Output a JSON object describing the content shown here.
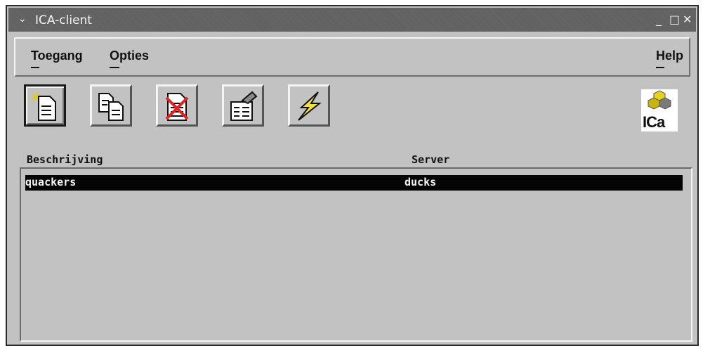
{
  "window": {
    "title": "ICA-client"
  },
  "menu": {
    "toegang": "Toegang",
    "opties": "Opties",
    "help": "Help"
  },
  "toolbar": {
    "buttons": [
      "new-entry",
      "copy-entry",
      "delete-entry",
      "properties",
      "connect"
    ]
  },
  "logo": {
    "text": "ICa"
  },
  "list": {
    "columns": {
      "description": "Beschrijving",
      "server": "Server"
    },
    "rows": [
      {
        "description": "quackers",
        "server": "ducks",
        "selected": true
      }
    ]
  },
  "colors": {
    "window_bg": "#c2c2c2",
    "selection": "#050505",
    "connect_icon": "#f2e23a"
  }
}
